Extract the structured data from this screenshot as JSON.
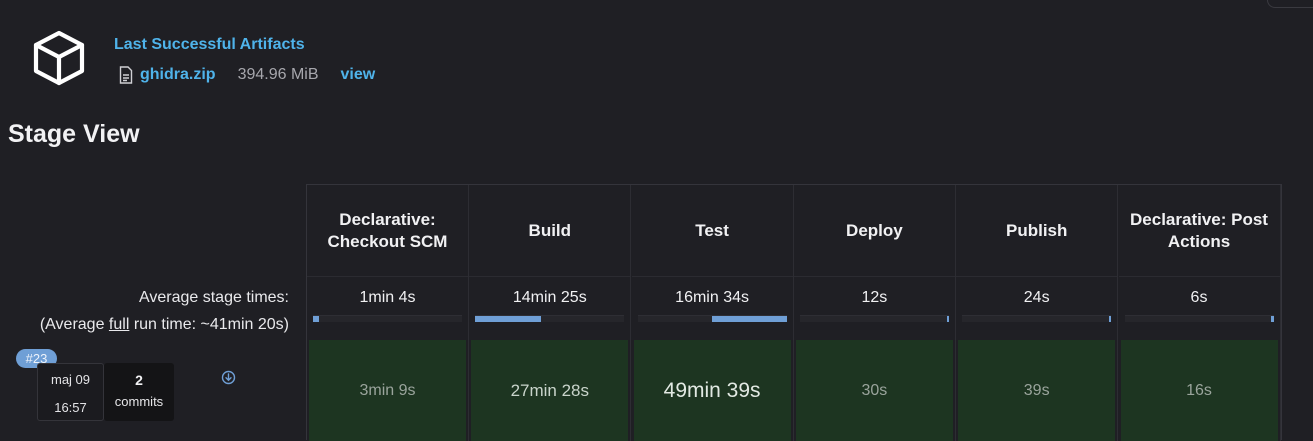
{
  "artifacts": {
    "title": "Last Successful Artifacts",
    "file_name": "ghidra.zip",
    "file_size": "394.96 MiB",
    "view_label": "view",
    "icon": "package-box-icon",
    "file_icon": "document-icon"
  },
  "stage_view": {
    "title": "Stage View",
    "avg_label_line1": "Average stage times:",
    "avg_label_pre": "(Average ",
    "avg_label_full": "full",
    "avg_label_post": " run time: ~41min 20s)",
    "stages": [
      {
        "name": "Declarative: Checkout SCM",
        "avg": "1min 4s",
        "avg_fraction": 0.04,
        "avg_align": "left",
        "run": "3min 9s"
      },
      {
        "name": "Build",
        "avg": "14min 25s",
        "avg_fraction": 0.44,
        "avg_align": "left",
        "run": "27min 28s"
      },
      {
        "name": "Test",
        "avg": "16min 34s",
        "avg_fraction": 0.5,
        "avg_align": "right",
        "run": "49min 39s"
      },
      {
        "name": "Deploy",
        "avg": "12s",
        "avg_fraction": 0.01,
        "avg_align": "right",
        "run": "30s"
      },
      {
        "name": "Publish",
        "avg": "24s",
        "avg_fraction": 0.01,
        "avg_align": "right",
        "run": "39s"
      },
      {
        "name": "Declarative: Post Actions",
        "avg": "6s",
        "avg_fraction": 0.01,
        "avg_align": "right",
        "run": "16s"
      }
    ],
    "build": {
      "number": "#23",
      "date": "maj 09",
      "time": "16:57",
      "commits_count": "2",
      "commits_label": "commits"
    }
  },
  "colors": {
    "background": "#1f1f24",
    "link": "#4fb3ea",
    "success_cell": "#1d3521",
    "progress": "#6f9fd6"
  }
}
